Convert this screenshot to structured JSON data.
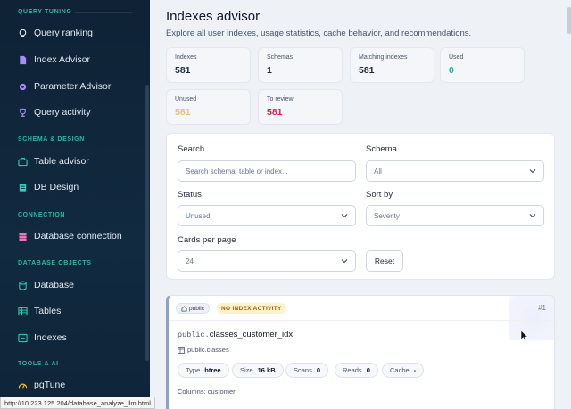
{
  "sidebar": {
    "sections": {
      "query_tuning": "QUERY TUNING",
      "schema_design": "SCHEMA & DESIGN",
      "connection": "CONNECTION",
      "database_objects": "DATABASE OBJECTS",
      "tools_ai": "TOOLS & AI"
    },
    "items": {
      "query_ranking": "Query ranking",
      "index_advisor": "Index Advisor",
      "parameter_advisor": "Parameter Advisor",
      "query_activity": "Query activity",
      "table_advisor": "Table advisor",
      "db_design": "DB Design",
      "database_connection": "Database connection",
      "database": "Database",
      "tables": "Tables",
      "indexes": "Indexes",
      "pgtune": "pgTune"
    }
  },
  "header": {
    "title": "Indexes advisor",
    "subtitle": "Explore all user indexes, usage statistics, cache behavior, and recommendations."
  },
  "stats": {
    "indexes": {
      "label": "Indexes",
      "value": "581"
    },
    "schemas": {
      "label": "Schemas",
      "value": "1"
    },
    "matching": {
      "label": "Matching indexes",
      "value": "581"
    },
    "used": {
      "label": "Used",
      "value": "0"
    },
    "unused": {
      "label": "Unused",
      "value": "581"
    },
    "to_review": {
      "label": "To review",
      "value": "581"
    }
  },
  "filters": {
    "search_label": "Search",
    "search_placeholder": "Search schema, table or index...",
    "schema_label": "Schema",
    "schema_value": "All",
    "status_label": "Status",
    "status_value": "Unused",
    "sort_label": "Sort by",
    "sort_value": "Severity",
    "cards_label": "Cards per page",
    "cards_value": "24",
    "reset_label": "Reset"
  },
  "card": {
    "schema_badge": "public",
    "warning_badge": "NO INDEX ACTIVITY",
    "rank": "#1",
    "schema_prefix": "public.",
    "index_name": "classes_customer_idx",
    "table": "public.classes",
    "type_label": "Type",
    "type_value": "btree",
    "size_label": "Size",
    "size_value": "16 kB",
    "scans_label": "Scans",
    "scans_value": "0",
    "reads_label": "Reads",
    "reads_value": "0",
    "cache_label": "Cache",
    "cache_value": "-",
    "columns_label": "Columns:",
    "columns_value": "customer"
  },
  "statusbar": {
    "url": "http://10.223.125.204/database_analyze_llm.html"
  },
  "colors": {
    "sidebar_bg": "#112a3f",
    "section_accent": "#2fb5a0",
    "used_value": "#14b8a6",
    "unused_value": "#f5b97a",
    "review_value": "#e11d48",
    "warning_badge_bg": "#fff2cc"
  }
}
